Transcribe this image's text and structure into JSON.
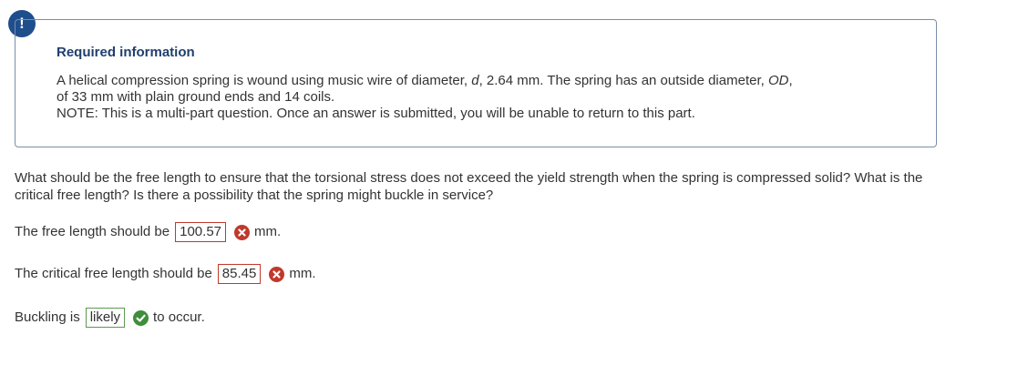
{
  "alert": {
    "symbol": "!"
  },
  "info": {
    "title": "Required information",
    "line1_pre": "A helical compression spring is wound using music wire of diameter, ",
    "line1_d": "d",
    "line1_mid": ", 2.64 mm. The spring has an outside diameter, ",
    "line1_od": "OD",
    "line1_post": ",",
    "line2": "of 33 mm with plain ground ends and 14 coils.",
    "note": "NOTE: This is a multi-part question. Once an answer is submitted, you will be unable to return to this part."
  },
  "question": {
    "text": "What should be the free length to ensure that the torsional stress does not exceed the yield strength when the spring is compressed solid? What is the critical free length? Is there a possibility that the spring might buckle in service?"
  },
  "answers": [
    {
      "label": "The free length should be",
      "value": "100.57",
      "status": "incorrect",
      "unit": "mm."
    },
    {
      "label": "The critical free length should be",
      "value": "85.45",
      "status": "incorrect",
      "unit": "mm."
    },
    {
      "label": "Buckling is",
      "value": "likely",
      "status": "correct",
      "unit": "to occur."
    }
  ],
  "colors": {
    "incorrect": "#c0392b",
    "correct": "#3e8e3a",
    "accent": "#1f4e8c"
  },
  "icons": {
    "incorrect": "x-circle-icon",
    "correct": "check-circle-icon",
    "alert": "exclamation-icon"
  }
}
